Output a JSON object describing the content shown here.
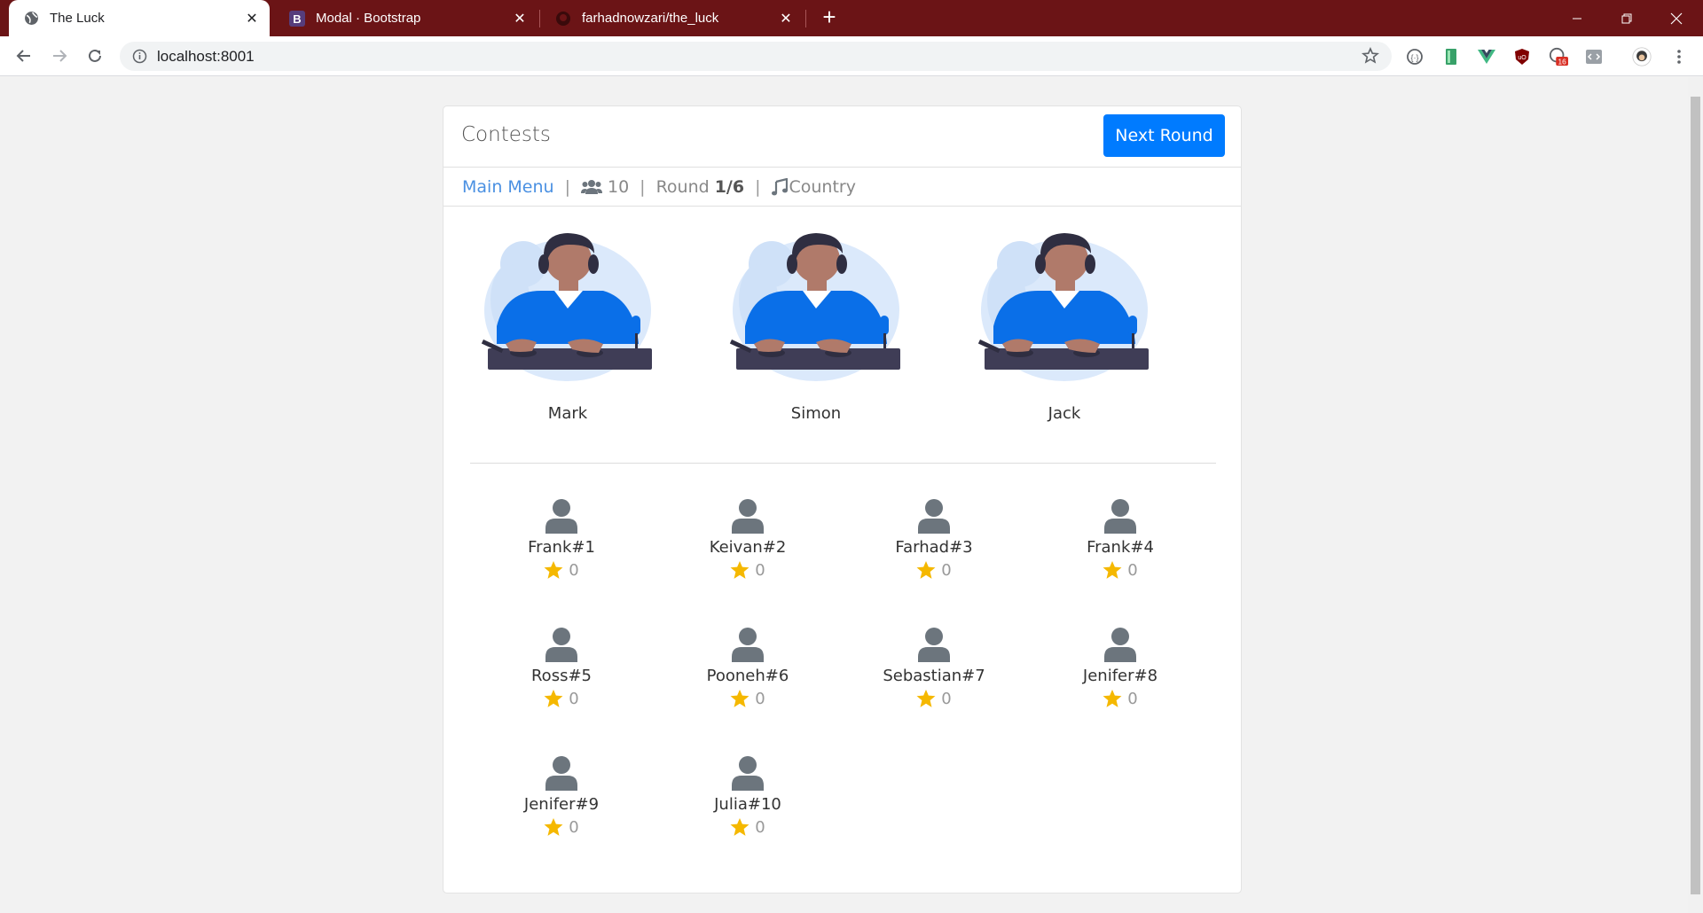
{
  "browser": {
    "tabs": [
      {
        "title": "The Luck",
        "active": true,
        "icon": "globe-icon"
      },
      {
        "title": "Modal · Bootstrap",
        "active": false,
        "icon": "bootstrap-icon"
      },
      {
        "title": "farhadnowzari/the_luck",
        "active": false,
        "icon": "github-icon"
      }
    ],
    "url": "localhost:8001",
    "extension_badge": "16",
    "colors": {
      "tabbar": "#6b1416",
      "accent": "#007bff"
    }
  },
  "header": {
    "title": "Contests",
    "next_button": "Next Round"
  },
  "subnav": {
    "main_menu": "Main Menu",
    "participants": "10",
    "round_label": "Round",
    "round_value": "1/6",
    "genre": "Country"
  },
  "judges": [
    {
      "name": "Mark"
    },
    {
      "name": "Simon"
    },
    {
      "name": "Jack"
    }
  ],
  "players": [
    {
      "name": "Frank#1",
      "score": "0"
    },
    {
      "name": "Keivan#2",
      "score": "0"
    },
    {
      "name": "Farhad#3",
      "score": "0"
    },
    {
      "name": "Frank#4",
      "score": "0"
    },
    {
      "name": "Ross#5",
      "score": "0"
    },
    {
      "name": "Pooneh#6",
      "score": "0"
    },
    {
      "name": "Sebastian#7",
      "score": "0"
    },
    {
      "name": "Jenifer#8",
      "score": "0"
    },
    {
      "name": "Jenifer#9",
      "score": "0"
    },
    {
      "name": "Julia#10",
      "score": "0"
    }
  ]
}
